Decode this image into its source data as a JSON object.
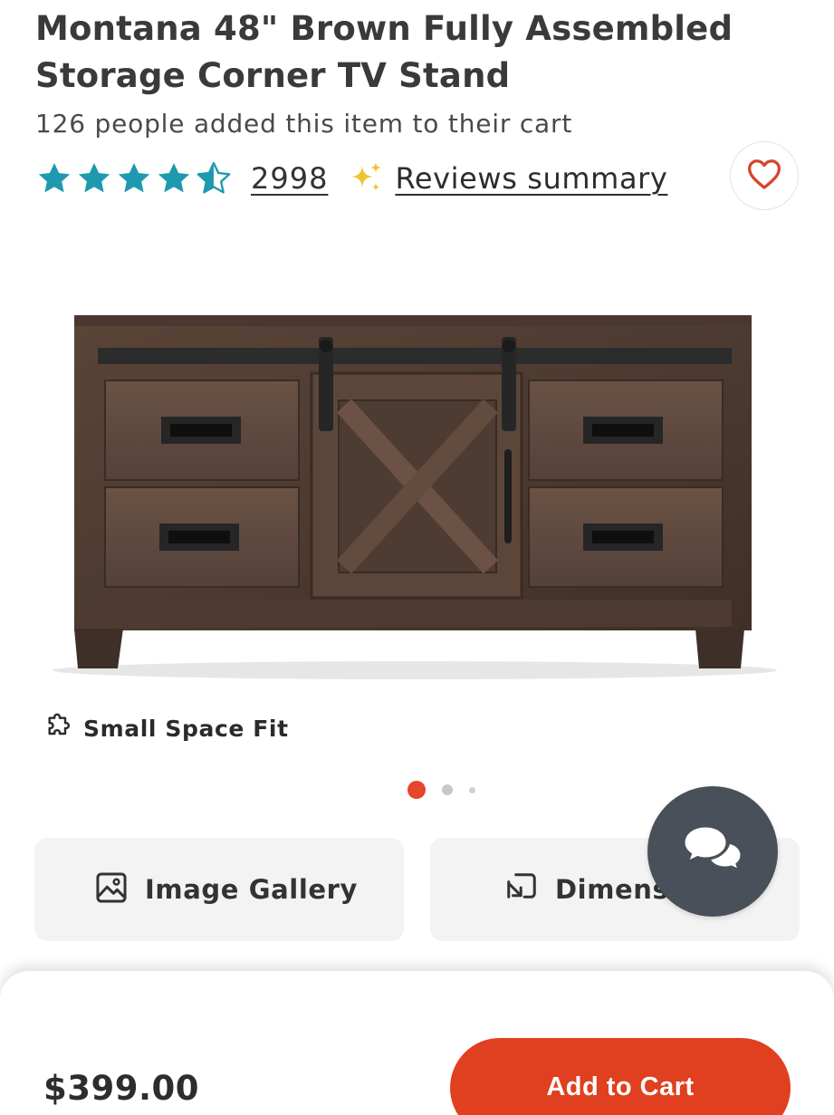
{
  "product": {
    "title": "Montana 48\" Brown Fully Assembled Storage Corner TV Stand",
    "added_to_cart_text": "126 people added this item to their cart",
    "rating": 4.5,
    "rating_max": 5,
    "review_count": "2998",
    "reviews_summary_label": "Reviews summary",
    "badge_label": "Small Space Fit",
    "price": "$399.00"
  },
  "carousel": {
    "total_slides": 3,
    "active_slide": 1
  },
  "actions": {
    "image_gallery_label": "Image Gallery",
    "dimensions_label": "Dimensions"
  },
  "cart": {
    "add_to_cart_label": "Add to Cart"
  },
  "icons": {
    "star": "star-icon",
    "half_star": "half-star-icon",
    "sparkle": "sparkle-icon",
    "heart": "heart-outline-icon",
    "puzzle": "puzzle-icon",
    "gallery": "image-icon",
    "dimensions": "resize-icon",
    "chat": "chat-bubbles-icon"
  },
  "colors": {
    "star": "#1e9aae",
    "accent": "#e0401f",
    "sparkle": "#f2c230",
    "heart": "#d8432a",
    "chat_fab": "#4a5059"
  }
}
